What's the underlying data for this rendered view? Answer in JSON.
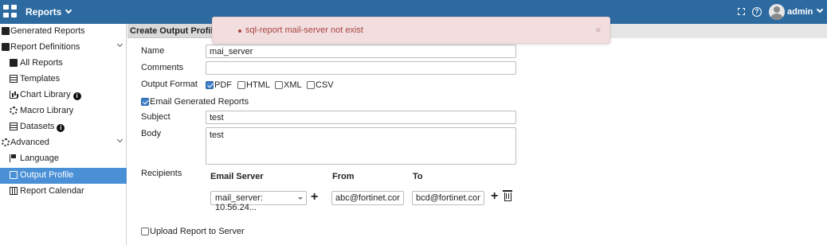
{
  "topbar": {
    "app_title": "Reports",
    "user": "admin",
    "icons": [
      "apps-grid-icon",
      "fullscreen-icon",
      "help-icon",
      "avatar"
    ]
  },
  "sidebar": {
    "items": [
      {
        "label": "Generated Reports",
        "icon": "document-icon"
      },
      {
        "label": "Report Definitions",
        "icon": "document-icon",
        "expanded": true
      },
      {
        "label": "All Reports",
        "icon": "document-icon"
      },
      {
        "label": "Templates",
        "icon": "table-icon"
      },
      {
        "label": "Chart Library",
        "icon": "bar-chart-icon",
        "info": "i"
      },
      {
        "label": "Macro Library",
        "icon": "gear-icon"
      },
      {
        "label": "Datasets",
        "icon": "list-icon",
        "info": "i"
      },
      {
        "label": "Advanced",
        "icon": "gear-icon",
        "expanded": true
      },
      {
        "label": "Language",
        "icon": "flag-icon"
      },
      {
        "label": "Output Profile",
        "icon": "output-profile-icon",
        "active": true
      },
      {
        "label": "Report Calendar",
        "icon": "calendar-icon"
      }
    ]
  },
  "panel": {
    "title": "Create Output Profile"
  },
  "form": {
    "name_label": "Name",
    "name_value": "mai_server",
    "comments_label": "Comments",
    "comments_value": "",
    "output_format_label": "Output Format",
    "formats": [
      {
        "label": "PDF",
        "checked": true
      },
      {
        "label": "HTML",
        "checked": false
      },
      {
        "label": "XML",
        "checked": false
      },
      {
        "label": "CSV",
        "checked": false
      }
    ],
    "email_generated_label": "Email Generated Reports",
    "email_generated_checked": true,
    "subject_label": "Subject",
    "subject_value": "test",
    "body_label": "Body",
    "body_value": "test",
    "recipients_label": "Recipients",
    "recipients_headers": {
      "server": "Email Server",
      "from": "From",
      "to": "To"
    },
    "recipient": {
      "server": "mail_server: 10.56.24...",
      "from": "abc@fortinet.com",
      "to": "bcd@fortinet.com"
    },
    "upload_label": "Upload Report to Server",
    "upload_checked": false
  },
  "toast": {
    "type": "error",
    "message": "sql-report mail-server not exist",
    "close": "×"
  },
  "colors": {
    "topbar": "#2c6aa0",
    "active_nav": "#4a90d6",
    "error_bg": "#f2dede",
    "error_text": "#a94442"
  }
}
